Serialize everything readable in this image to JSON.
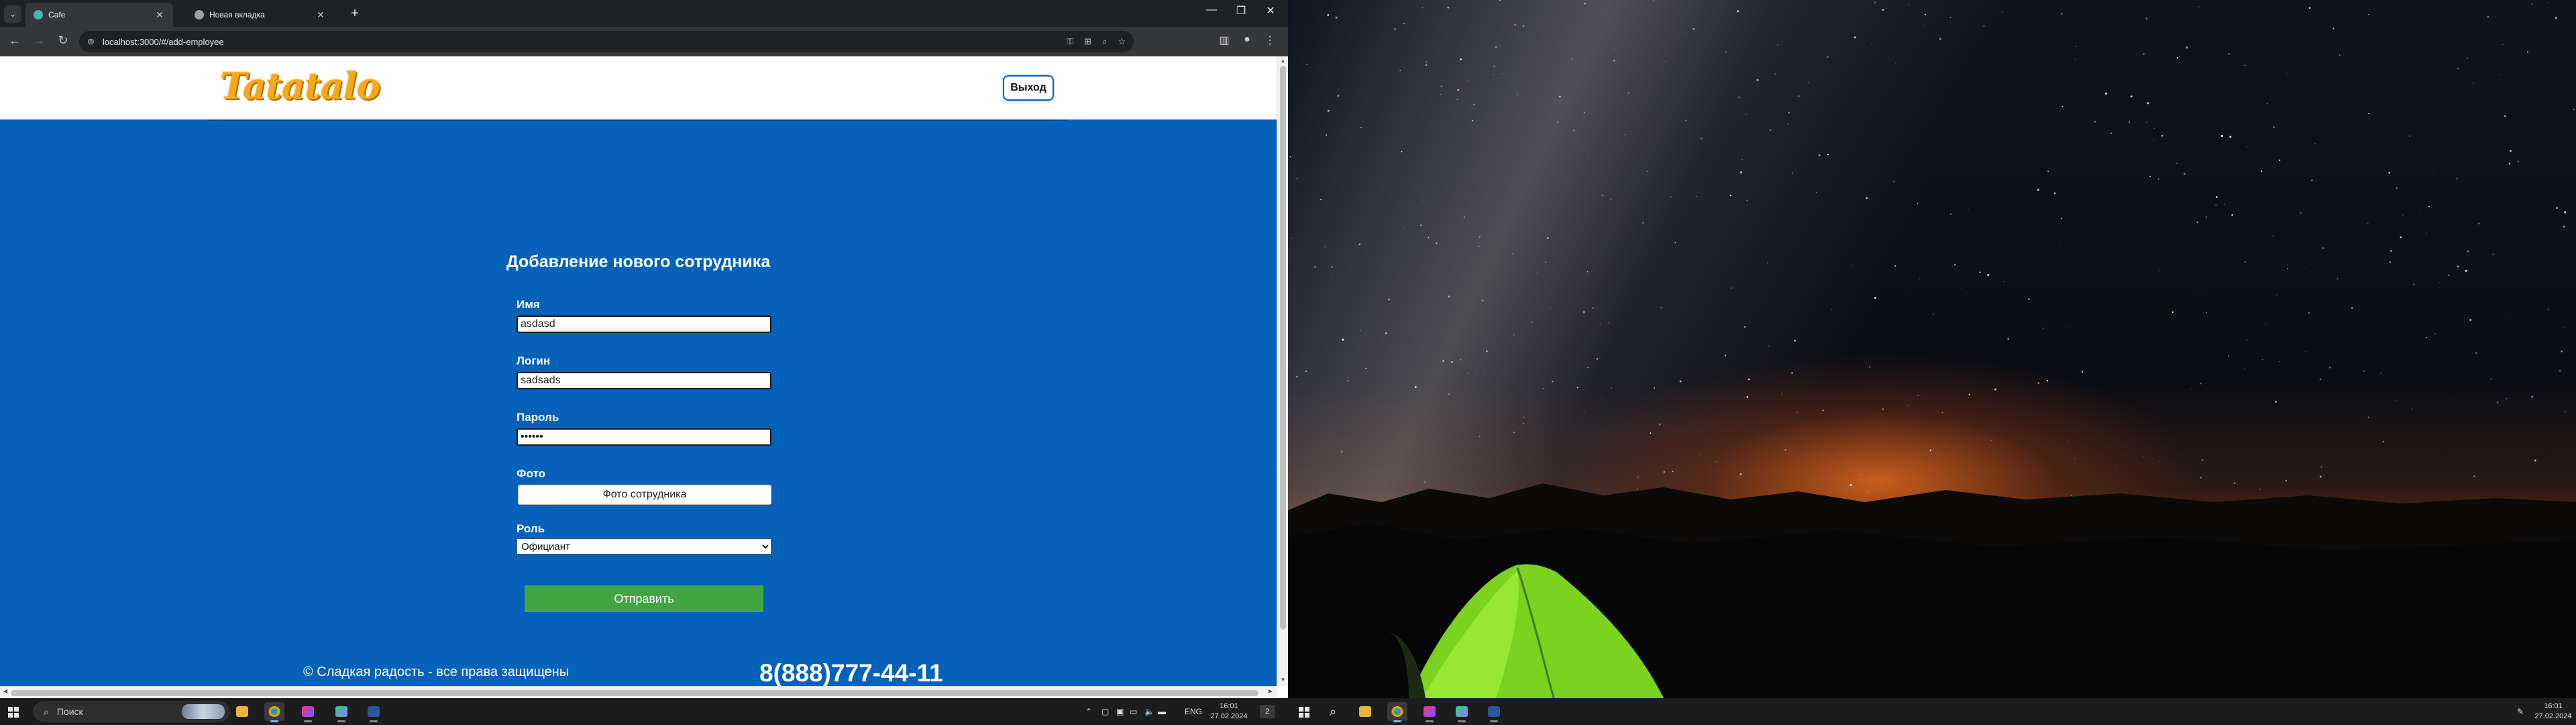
{
  "browser": {
    "tabs": [
      {
        "title": "Cafe",
        "active": true,
        "favicon_color": "#4db6ac"
      },
      {
        "title": "Новая вкладка",
        "active": false,
        "favicon_color": "#9aa0a6"
      }
    ],
    "url": "localhost:3000/#/add-employee"
  },
  "site": {
    "logo_text": "Tatatalo",
    "logout_label": "Выход"
  },
  "form": {
    "title": "Добавление нового сотрудника",
    "name_label": "Имя",
    "name_value": "asdasd",
    "login_label": "Логин",
    "login_value": "sadsads",
    "password_label": "Пароль",
    "password_value": "••••••",
    "photo_label": "Фото",
    "photo_button": "Фото сотрудника",
    "role_label": "Роль",
    "role_value": "Официант",
    "submit_label": "Отправить"
  },
  "footer": {
    "copyright": "© Сладкая радость - все права защищены",
    "phone": "8(888)777-44-11"
  },
  "taskbar_left": {
    "search_placeholder": "Поиск",
    "lang": "ENG",
    "time": "16:01",
    "date": "27.02.2024",
    "notification_count": "2"
  },
  "taskbar_right": {
    "time": "16:01",
    "date": "27.02.2024"
  },
  "colors": {
    "page_background": "#0562b8",
    "submit_button": "#41a542",
    "logo": "#f4a91c"
  }
}
